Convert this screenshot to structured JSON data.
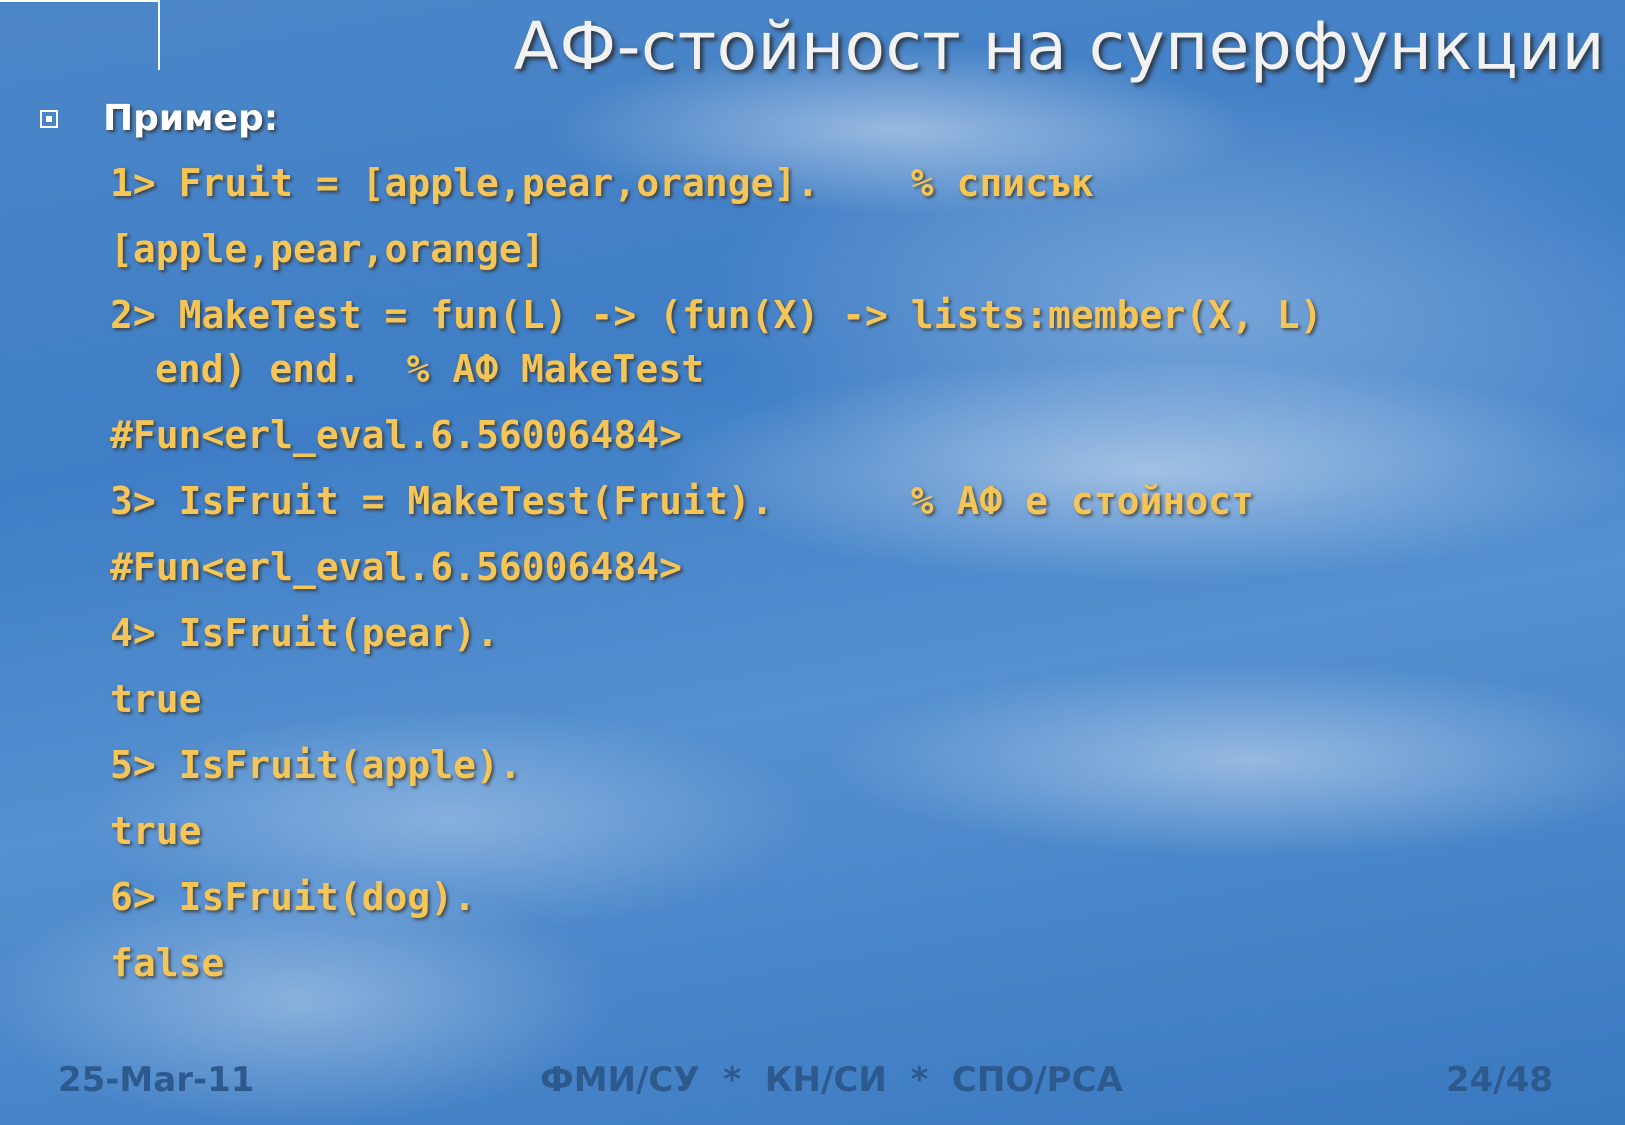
{
  "slide": {
    "title": "АФ-стойност на суперфункции",
    "bullet": "Пример:",
    "code_lines": [
      "1> Fruit = [apple,pear,orange].    % списък",
      "[apple,pear,orange]",
      "2> MakeTest = fun(L) -> (fun(X) -> lists:member(X, L)",
      "end) end.  % АФ MakeTest",
      "#Fun<erl_eval.6.56006484>",
      "3> IsFruit = MakeTest(Fruit).      % АФ е стойност",
      "#Fun<erl_eval.6.56006484>",
      "4> IsFruit(pear).",
      "true",
      "5> IsFruit(apple).",
      "true",
      "6> IsFruit(dog).",
      "false"
    ]
  },
  "footer": {
    "date": "25-Mar-11",
    "center": "ФМИ/СУ  *  КН/СИ  *  СПО/РСА",
    "page": "24/48"
  },
  "colors": {
    "code": "#f5c557",
    "title": "#f2f2f2",
    "footer": "#2d5a8e",
    "sky": "#3f7ec6"
  }
}
